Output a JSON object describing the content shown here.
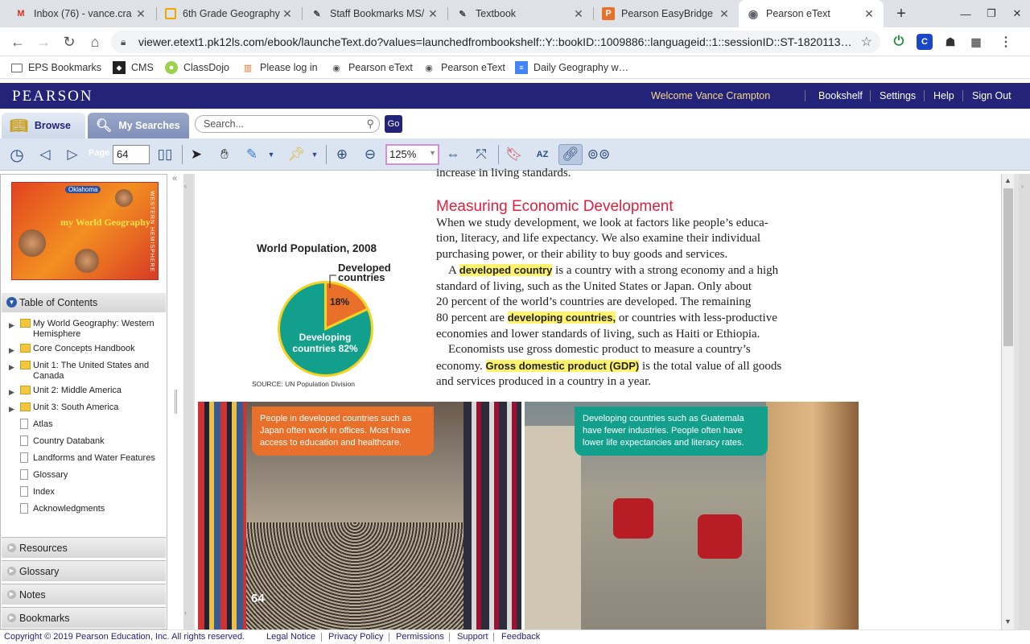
{
  "browser": {
    "tabs": [
      {
        "title": "Inbox (76) - vance.cra",
        "favicon": "M",
        "color": "#d93025",
        "active": false
      },
      {
        "title": "6th Grade Geography",
        "favicon": "▢",
        "color": "#f2a600",
        "active": false
      },
      {
        "title": "Staff Bookmarks MS/",
        "favicon": "✎",
        "color": "#444",
        "active": false
      },
      {
        "title": "Textbook",
        "favicon": "✎",
        "color": "#444",
        "active": false
      },
      {
        "title": "Pearson EasyBridge",
        "favicon": "P",
        "color": "#e8702a",
        "active": false
      },
      {
        "title": "Pearson eText",
        "favicon": "◉",
        "color": "#5f6368",
        "active": true
      }
    ],
    "new_tab": "+",
    "url": "viewer.etext1.pk12ls.com/ebook/launcheText.do?values=launchedfrombookshelf::Y::bookID::1009886::languageid::1::sessionID::ST-1820113…",
    "bookmarks": [
      {
        "label": "EPS Bookmarks",
        "icon": "folder-icon"
      },
      {
        "label": "CMS",
        "icon": "cms-icon"
      },
      {
        "label": "ClassDojo",
        "icon": "dojo-icon"
      },
      {
        "label": "Please log in",
        "icon": "chart-icon"
      },
      {
        "label": "Pearson eText",
        "icon": "globe-icon"
      },
      {
        "label": "Pearson eText",
        "icon": "globe-icon"
      },
      {
        "label": "Daily Geography w…",
        "icon": "doc-icon"
      }
    ]
  },
  "pearson": {
    "logo": "PEARSON",
    "welcome": "Welcome Vance Crampton",
    "links": [
      "Bookshelf",
      "Settings",
      "Help",
      "Sign Out"
    ],
    "tabs": {
      "browse": "Browse",
      "searches": "My Searches"
    },
    "search_placeholder": "Search...",
    "go": "Go",
    "page_label": "Page",
    "page_value": "64",
    "zoom_value": "125%"
  },
  "sidebar": {
    "cover_title": "my World Geography",
    "cover_badge": "Oklahoma",
    "cover_side": "WESTERN HEMISPHERE",
    "toc_header": "Table of Contents",
    "toc": [
      {
        "label": "My World Geography: Western Hemisphere",
        "type": "folder"
      },
      {
        "label": "Core Concepts Handbook",
        "type": "folder"
      },
      {
        "label": "Unit 1: The United States and Canada",
        "type": "folder"
      },
      {
        "label": "Unit 2: Middle America",
        "type": "folder"
      },
      {
        "label": "Unit 3: South America",
        "type": "folder"
      },
      {
        "label": "Atlas",
        "type": "page"
      },
      {
        "label": "Country Databank",
        "type": "page"
      },
      {
        "label": "Landforms and Water Features",
        "type": "page"
      },
      {
        "label": "Glossary",
        "type": "page"
      },
      {
        "label": "Index",
        "type": "page"
      },
      {
        "label": "Acknowledgments",
        "type": "page"
      }
    ],
    "panels": [
      "Resources",
      "Glossary",
      "Notes",
      "Bookmarks"
    ]
  },
  "book": {
    "cut_line": "increase in living standards.",
    "heading": "Measuring Economic Development",
    "lines": [
      [
        "When we study development, we look at factors like people’s educa-"
      ],
      [
        "tion, literacy, and life expectancy. We also examine their individual"
      ],
      [
        "purchasing power, or their ability to buy goods and services."
      ],
      [
        "    A ",
        {
          "hl": "developed country"
        },
        " is a country with a strong economy and a high"
      ],
      [
        "standard of living, such as the United States or Japan. Only about"
      ],
      [
        "20 percent of the world’s countries are developed. The remaining"
      ],
      [
        "80 percent are ",
        {
          "hl": "developing countries,"
        },
        " or countries with less-productive"
      ],
      [
        "economies and lower standards of living, such as Haiti or Ethiopia."
      ],
      [
        "    Economists use gross domestic product to measure a country’s"
      ],
      [
        "economy. ",
        {
          "hl": "Gross domestic product (GDP)"
        },
        " is the total value of all goods"
      ],
      [
        "and services produced in a country in a year."
      ]
    ],
    "caption_left": "People in developed countries such as Japan often work in offices. Most have access to education and healthcare.",
    "caption_right": "Developing countries such as Guatemala have fewer industries. People often have lower life expectancies and literacy rates.",
    "page_number": "64"
  },
  "chart_data": {
    "type": "pie",
    "title": "World Population, 2008",
    "source": "SOURCE: UN Population Division",
    "slices": [
      {
        "label": "Developed countries",
        "value": 18,
        "display": "18%",
        "color": "#e8702a"
      },
      {
        "label": "Developing countries 82%",
        "value": 82,
        "display": "",
        "color": "#12a08c"
      }
    ],
    "border_color": "#f6d21e"
  },
  "footer": {
    "copyright": "Copyright © 2019 Pearson Education, Inc. All rights reserved.",
    "links": [
      "Legal Notice",
      "Privacy Policy",
      "Permissions",
      "Support",
      "Feedback"
    ]
  }
}
